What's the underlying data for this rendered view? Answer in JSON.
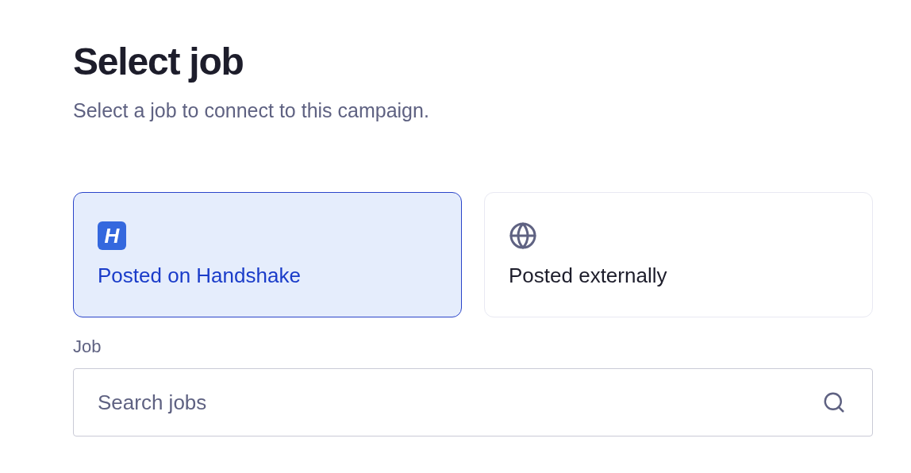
{
  "title": "Select job",
  "subtitle": "Select a job to connect to this campaign.",
  "options": [
    {
      "kind": "handshake",
      "logo_text": "H",
      "label": "Posted on Handshake",
      "selected": true
    },
    {
      "kind": "globe",
      "label": "Posted externally",
      "selected": false
    }
  ],
  "job_field": {
    "label": "Job",
    "placeholder": "Search jobs"
  }
}
